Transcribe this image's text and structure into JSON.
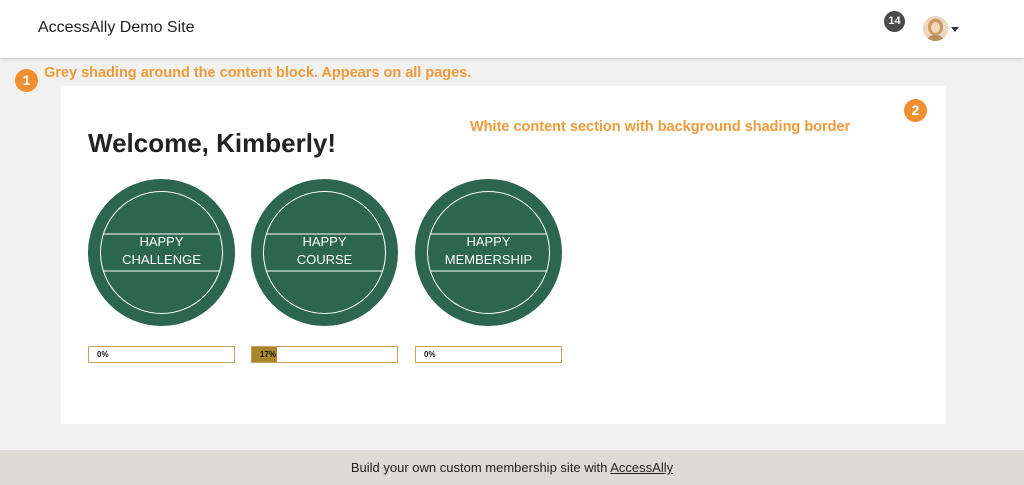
{
  "header": {
    "site_title": "AccessAlly Demo Site",
    "notification_count": "14",
    "avatar_icon": "user-avatar",
    "menu_icon": "caret-down-icon"
  },
  "annotations": [
    {
      "number": "1",
      "text": "Grey shading around the content block. Appears on all pages."
    },
    {
      "number": "2",
      "text": "White content section with background shading border"
    }
  ],
  "main": {
    "welcome": "Welcome, Kimberly!",
    "cards": [
      {
        "line1": "HAPPY",
        "line2": "CHALLENGE",
        "progress": 0,
        "progress_label": "0%"
      },
      {
        "line1": "HAPPY",
        "line2": "COURSE",
        "progress": 17,
        "progress_label": "17%"
      },
      {
        "line1": "HAPPY",
        "line2": "MEMBERSHIP",
        "progress": 0,
        "progress_label": "0%"
      }
    ]
  },
  "footer": {
    "text": "Build your own custom membership site with",
    "link": "AccessAlly"
  },
  "colors": {
    "card_green": "#2c6650",
    "callout_orange": "#ef8f30",
    "progress_fill": "#a98729",
    "progress_border": "#c8a065",
    "page_grey": "#f1f1f1",
    "footer_bg": "#dcdad6"
  }
}
